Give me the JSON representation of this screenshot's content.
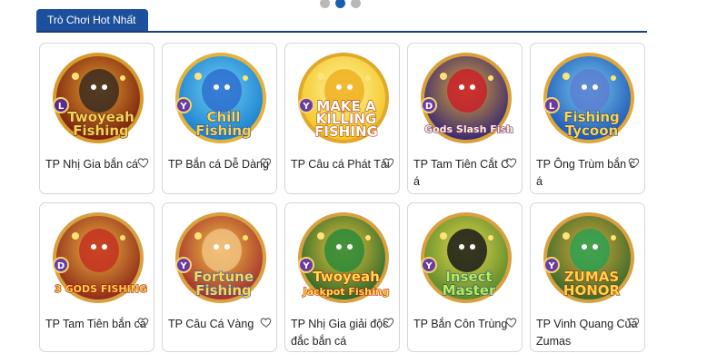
{
  "section": {
    "title": "Trò Chơi Hot Nhất"
  },
  "pagination": {
    "pages": 3,
    "active": 2
  },
  "colors": {
    "accent": "#1c4f9c",
    "border": "#d6d6d6",
    "dot_inactive": "#b8b8b8",
    "dot_active": "#1b5fb0"
  },
  "games": [
    {
      "name": "TP Nhị Gia bắn cá",
      "badge": "L",
      "logo_lines": [
        "Twoyeah",
        "Fishing"
      ],
      "icon": "heart-icon"
    },
    {
      "name": "TP Bắn cá Dễ Dàng",
      "badge": "Y",
      "logo_lines": [
        "Chill",
        "Fishing"
      ],
      "icon": "heart-icon"
    },
    {
      "name": "TP Câu cá Phát Tài",
      "badge": "Y",
      "logo_lines": [
        "MAKE A",
        "KILLING",
        "FISHING"
      ],
      "icon": "heart-icon"
    },
    {
      "name": "TP Tam Tiên Cắt Cá",
      "badge": "D",
      "logo_lines": [
        "Gods Slash Fish"
      ],
      "icon": "heart-icon"
    },
    {
      "name": "TP Ông Trùm bắn cá",
      "badge": "L",
      "logo_lines": [
        "Fishing",
        "Tycoon"
      ],
      "icon": "heart-icon"
    },
    {
      "name": "TP Tam Tiên bắn cá",
      "badge": "D",
      "logo_lines": [
        "3 GODS FISHING"
      ],
      "icon": "heart-icon"
    },
    {
      "name": "TP Câu Cá Vàng",
      "badge": "Y",
      "logo_lines": [
        "Fortune",
        "Fishing"
      ],
      "icon": "heart-icon"
    },
    {
      "name": "TP Nhị Gia giải độc đắc bắn cá",
      "badge": "Y",
      "logo_lines": [
        "Twoyeah",
        "Jackpot Fishing"
      ],
      "icon": "heart-icon"
    },
    {
      "name": "TP Bắn Côn Trùng",
      "badge": "Y",
      "logo_lines": [
        "Insect",
        "Master"
      ],
      "icon": "heart-icon"
    },
    {
      "name": "TP Vinh Quang Của Zumas",
      "badge": "Y",
      "logo_lines": [
        "ZUMAS",
        "HONOR"
      ],
      "icon": "heart-icon"
    }
  ]
}
